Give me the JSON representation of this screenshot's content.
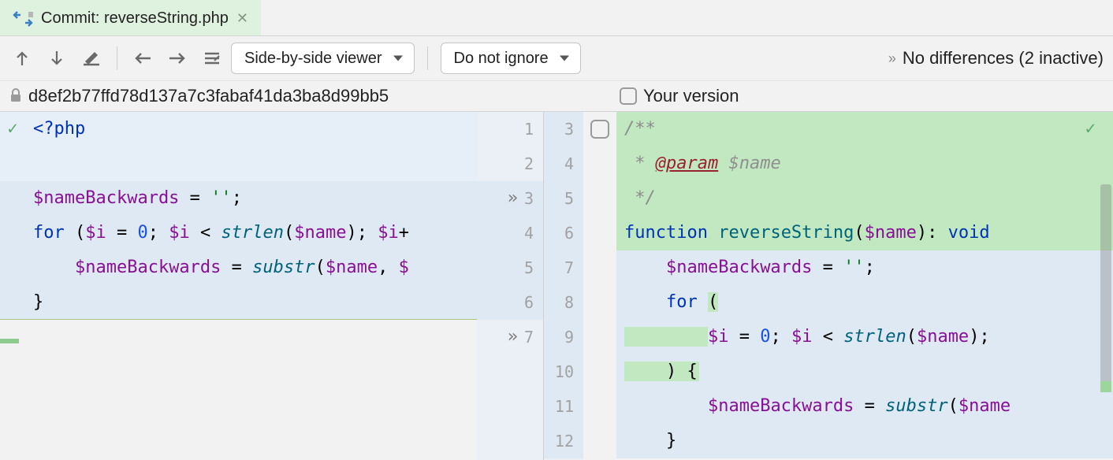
{
  "tab": {
    "title": "Commit: reverseString.php"
  },
  "toolbar": {
    "viewer": "Side-by-side viewer",
    "ignore": "Do not ignore"
  },
  "status": "No differences (2 inactive)",
  "header": {
    "hash": "d8ef2b77ffd78d137a7c3fabaf41da3ba8d99bb5",
    "right_label": "Your version"
  },
  "left": {
    "gutterMarker": [
      "",
      "",
      "»",
      "",
      "",
      "",
      "»"
    ],
    "lineNums": [
      "1",
      "2",
      "3",
      "4",
      "5",
      "6",
      "7"
    ],
    "code": {
      "l1_a": "<?",
      "l1_b": "php",
      "l3_a": "$nameBackwards",
      "l3_b": " = ",
      "l3_c": "''",
      "l3_d": ";",
      "l4_a": "for ",
      "l4_b": "(",
      "l4_c": "$i",
      "l4_d": " = ",
      "l4_e": "0",
      "l4_f": "; ",
      "l4_g": "$i",
      "l4_h": " < ",
      "l4_i": "strlen",
      "l4_j": "(",
      "l4_k": "$name",
      "l4_l": "); ",
      "l4_m": "$i",
      "l4_n": "+",
      "l5_a": "    ",
      "l5_b": "$nameBackwards",
      "l5_c": " = ",
      "l5_d": "substr",
      "l5_e": "(",
      "l5_f": "$name",
      "l5_g": ", ",
      "l5_h": "$",
      "l6_a": "}"
    }
  },
  "right": {
    "lineNums": [
      "3",
      "4",
      "5",
      "6",
      "7",
      "8",
      "9",
      "10",
      "11",
      "12"
    ],
    "code": {
      "l3_a": "/**",
      "l4_a": " * ",
      "l4_b": "@param",
      "l4_c": " ",
      "l4_d": "$name",
      "l5_a": " */",
      "l6_a": "function ",
      "l6_b": "reverseString",
      "l6_c": "(",
      "l6_d": "$name",
      "l6_e": "): ",
      "l6_f": "void",
      "l7_a": "    ",
      "l7_b": "$nameBackwards",
      "l7_c": " = ",
      "l7_d": "''",
      "l7_e": ";",
      "l8_a": "    ",
      "l8_b": "for ",
      "l8_c": "(",
      "l9_a": "        ",
      "l9_b": "$i",
      "l9_c": " = ",
      "l9_d": "0",
      "l9_e": "; ",
      "l9_f": "$i",
      "l9_g": " < ",
      "l9_h": "strlen",
      "l9_i": "(",
      "l9_j": "$name",
      "l9_k": ");",
      "l10_a": "    ) {",
      "l11_a": "        ",
      "l11_b": "$nameBackwards",
      "l11_c": " = ",
      "l11_d": "substr",
      "l11_e": "(",
      "l11_f": "$name",
      "l12_a": "    }"
    }
  }
}
